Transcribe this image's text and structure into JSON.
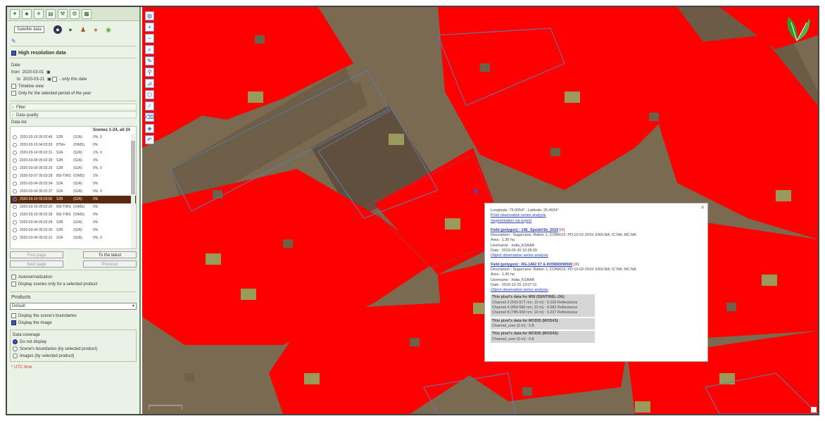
{
  "sidebar": {
    "tooltip": "Satellite data",
    "high_res_label": "High resolution data",
    "date_label": "Date",
    "from_label": "from",
    "from_value": "2020-03-01",
    "to_label": "to",
    "to_value": "2020-03-21",
    "only_this_date": "- only this date",
    "timeline_view": "Timeline view",
    "only_period": "Only for the selected period of the year",
    "filter_label": "Filter",
    "data_quality_label": "Data quality",
    "data_list_label": "Data list",
    "scenes_header": "Scenes 1-24, all 24",
    "scenes": [
      {
        "date": "2020-03-19 05:02:46",
        "sat": "S2B",
        "type": "(S2A)",
        "cloud": "0%, 0"
      },
      {
        "date": "2020-03-19 04:03:29",
        "sat": "8TM+",
        "type": "(OIMS)",
        "cloud": "0%"
      },
      {
        "date": "2020-03-14 05:02:31",
        "sat": "S2A",
        "type": "(S2A)",
        "cloud": "1%, 0"
      },
      {
        "date": "2020-03-09 05:02:28",
        "sat": "S2B",
        "type": "(S2A)",
        "cloud": "0%"
      },
      {
        "date": "2020-03-09 05:02:26",
        "sat": "S2B",
        "type": "(S2A)",
        "cloud": "0%, 0"
      },
      {
        "date": "2020-03-07 05:03:28",
        "sat": "8SI-TIRS",
        "type": "(OIMS)",
        "cloud": "1%"
      },
      {
        "date": "2020-03-04 05:02:34",
        "sat": "S2A",
        "type": "(S2A)",
        "cloud": "0%"
      },
      {
        "date": "2020-03-04 05:02:37",
        "sat": "S2A",
        "type": "(S2A)",
        "cloud": "0%, 0"
      },
      {
        "date": "2020-03-14 05:03:05",
        "sat": "S2B",
        "type": "(S2A)",
        "cloud": "0%"
      },
      {
        "date": "2020-03-19 05:02:26",
        "sat": "8SI-TIRS",
        "type": "(OIMS)",
        "cloud": "0%"
      },
      {
        "date": "2020-03-19 05:02:28",
        "sat": "8SI-TIRS",
        "type": "(OIMS)",
        "cloud": "0%"
      },
      {
        "date": "2020-03-04 05:02:28",
        "sat": "S2B",
        "type": "(S2A)",
        "cloud": "0%"
      },
      {
        "date": "2020-03-04 05:02:30",
        "sat": "S2B",
        "type": "(S2A)",
        "cloud": "0%"
      },
      {
        "date": "2020-03-04 05:02:31",
        "sat": "S2A",
        "type": "(S2A)",
        "cloud": "0%, 0"
      }
    ],
    "selected_index": 8,
    "btn_first": "First page",
    "btn_to_latest": "To the latest",
    "btn_next": "Next page",
    "btn_previous": "Previous",
    "autonormalization": "Autonormalization",
    "display_selected_product": "Display scenes only for a selected product",
    "products_label": "Products",
    "products_value": "Default",
    "display_boundaries": "Display the scene's boundaries",
    "display_image": "Display the image",
    "coverage_label": "Data coverage",
    "cov_none": "Do not display",
    "cov_boundaries": "Scene's boundaries (by selected product)",
    "cov_images": "Images (by selected product)",
    "note": "* UTC time"
  },
  "popup": {
    "coords": "Longitude: 75.0054° , Latitude: 26.4924°",
    "link_point": "Point observation series analysis",
    "link_segmentation": "Segmentation via export",
    "field1_title": "Field (polygon) : 14E_Spot&#1b_2019",
    "field1_desc": "Description : Sugarcane; Ration 1; CONKO2; PD:10-02-2019; ENS:NA; IC:NA; MC:NA",
    "field1_area": "Area : 1.36 ha",
    "field1_user": "Username : India_KSAAR",
    "field1_date": "Date : 2019-05-30 16:38:09",
    "field1_link": "Object observation series analysis",
    "field2_title": "Field (polygon) : RG-1462 07 & 8VD8000W000",
    "field2_desc": "Description : Sugarcane; Ration 1; CONKO2; PD:10-02-2019; ENS:NA; IC:NA; MC:NA",
    "field2_area": "Area : 1.36 ha",
    "field2_user": "Username : India_KSAAR",
    "field2_date": "Date : 2019-12-25 19:07:11",
    "field2_link": "Object observation series analysis",
    "pixel_header": "This pixel's data for MSI (SENTINEL-2A):",
    "pixel_rows": [
      "Channel 3 (543-577 nm; 10 m) : 0.103 Reflectance",
      "Channel 4 (650-680 nm; 10 m) : 0.082 Reflectance",
      "Channel 8 (785-900 nm; 10 m) : 0.237 Reflectance"
    ],
    "modis1_header": "This pixel's data for MODIS (MOD43):",
    "modis1_row": "Channel_user (0 m) : 0.8",
    "modis2_header": "This pixel's data for MODIS (MOD43):",
    "modis2_row": "Channel_user (0 m) : 0.8"
  },
  "colors": {
    "red_mask": "#ff0000",
    "field_boundary": "#5a7fb0",
    "map_bg": "#7b6a52",
    "sidebar_bg": "#e9f2e4"
  },
  "map_tools": [
    "globe-icon",
    "zoom-in-icon",
    "zoom-out-icon",
    "search-icon",
    "pencil-icon",
    "magnifier-icon",
    "measure-icon",
    "polygon-icon",
    "line-icon",
    "erase-icon",
    "layers-icon",
    "undo-icon"
  ]
}
